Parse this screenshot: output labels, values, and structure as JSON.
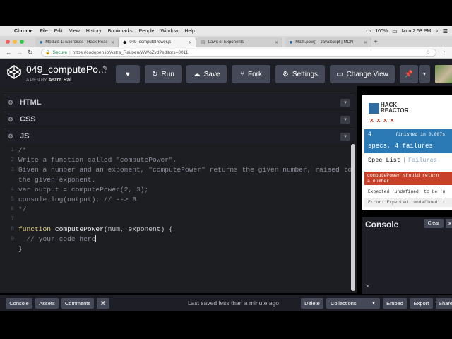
{
  "os_menubar": {
    "app": "Chrome",
    "items": [
      "File",
      "Edit",
      "View",
      "History",
      "Bookmarks",
      "People",
      "Window",
      "Help"
    ],
    "battery": "100%",
    "clock": "Mon 2:58 PM"
  },
  "browser": {
    "tabs": [
      {
        "title": "Module 1: Exercises | Hack Reac",
        "active": false
      },
      {
        "title": "049_computePower.js",
        "active": true
      },
      {
        "title": "Laws of Exponents",
        "active": false
      },
      {
        "title": "Math.pow() - JavaScript | MDN",
        "active": false
      }
    ],
    "secure_label": "Secure",
    "url": "https://codepen.io/Astra_Rai/pen/WWoZvd?editors=0011"
  },
  "header": {
    "pen_title": "049_computePo...",
    "by_label": "A PEN BY",
    "author": "Astra Rai",
    "buttons": {
      "run": "Run",
      "save": "Save",
      "fork": "Fork",
      "settings": "Settings",
      "change_view": "Change View"
    }
  },
  "panels": {
    "html": "HTML",
    "css": "CSS",
    "js": "JS"
  },
  "code_lines": [
    "/*",
    "Write a function called \"computePower\".",
    "Given a number and an exponent, \"computePower\" returns the given number, raised to",
    "the given exponent.",
    "var output = computePower(2, 3);",
    "console.log(output); // --> 8",
    "*/",
    "",
    "function computePower(num, exponent) {",
    "  // your code here",
    "}"
  ],
  "code_tokens": {
    "keyword": "function",
    "fn_name": "computePower",
    "args": "(num, exponent) {",
    "comment": "  // your code here",
    "close": "}"
  },
  "results": {
    "brand_line1": "HACK",
    "brand_line2": "REACTOR",
    "fail_marks": "x x x x",
    "spec_count": "4",
    "finished": "finished in 0.007s",
    "specs_summary": "specs, 4 failures",
    "tab_spec_list": "Spec List",
    "tab_separator": "|",
    "tab_failures": "Failures",
    "fail_title_1": "computePower should return",
    "fail_title_2": "a number",
    "fail_msg_1": "Expected 'undefined' to be 'n",
    "fail_msg_2": "Error: Expected 'undefined' t"
  },
  "console": {
    "title": "Console",
    "clear": "Clear",
    "prompt": ">"
  },
  "footer": {
    "console": "Console",
    "assets": "Assets",
    "comments": "Comments",
    "shortcut": "⌘",
    "saved_status": "Last saved less than a minute ago",
    "delete": "Delete",
    "collections": "Collections",
    "embed": "Embed",
    "export": "Export",
    "share": "Share"
  },
  "colors": {
    "editor_bg": "#1d1e22",
    "button_bg": "#444857",
    "summary_blue": "#2b7ab6",
    "fail_red": "#c7402a"
  }
}
